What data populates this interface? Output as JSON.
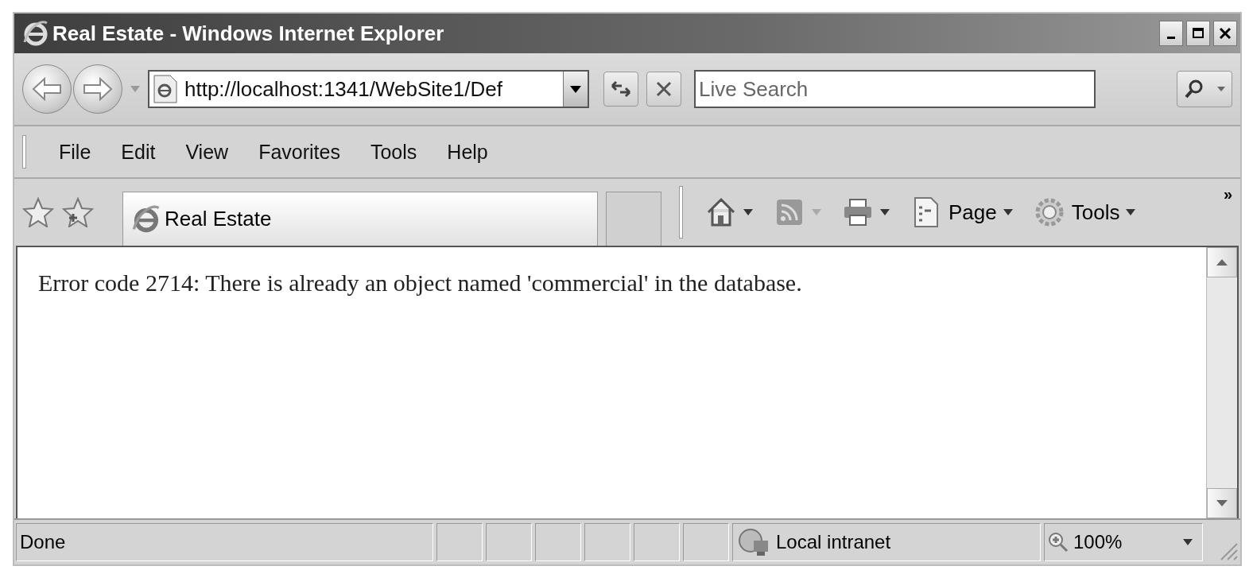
{
  "window": {
    "title": "Real Estate - Windows Internet Explorer"
  },
  "address_bar": {
    "value": "http://localhost:1341/WebSite1/Def"
  },
  "search": {
    "placeholder": "Live Search"
  },
  "menu": [
    "File",
    "Edit",
    "View",
    "Favorites",
    "Tools",
    "Help"
  ],
  "tab": {
    "label": "Real Estate",
    "selected": true
  },
  "command_bar": [
    {
      "kind": "home",
      "disabled": false
    },
    {
      "kind": "feeds",
      "disabled": true
    },
    {
      "kind": "print",
      "disabled": false
    },
    {
      "kind": "page",
      "label": "Page",
      "disabled": false
    },
    {
      "kind": "tools",
      "label": "Tools",
      "disabled": false
    }
  ],
  "toolbar_overflow": "»",
  "page": {
    "text": "Error code 2714: There is already an object named 'commercial' in the database."
  },
  "status_bar": {
    "status": "Done",
    "zone": "Local intranet",
    "zoom": "100%"
  }
}
